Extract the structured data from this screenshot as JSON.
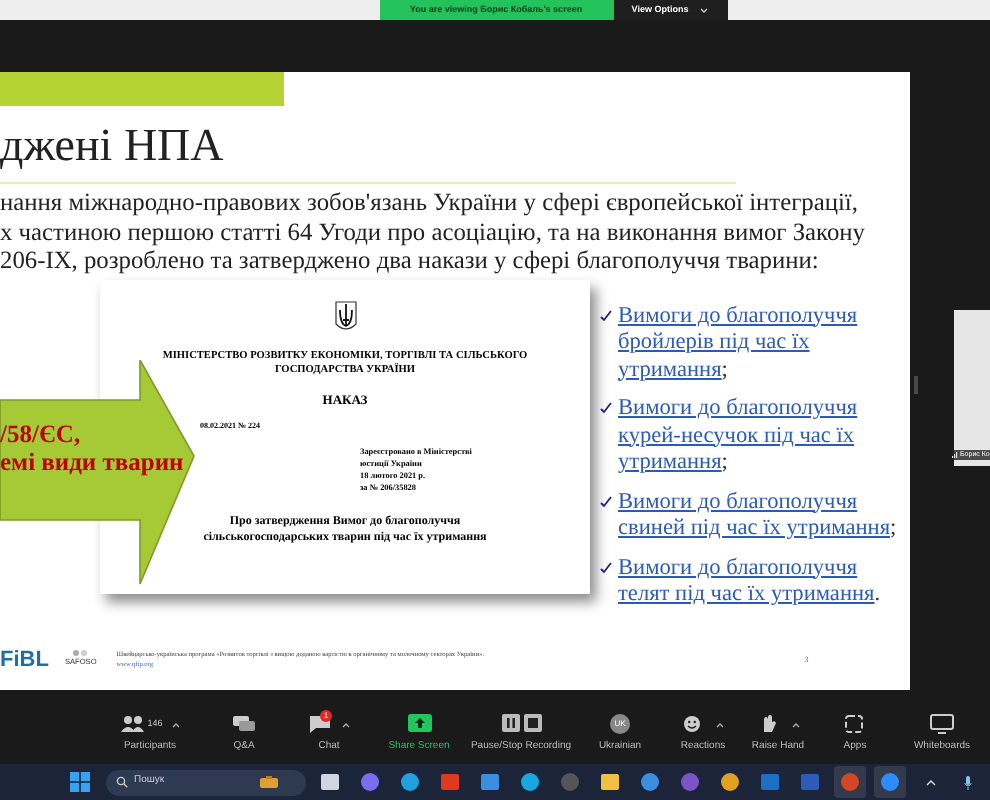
{
  "banner": {
    "message": "You are viewing Борис Кобаль's screen",
    "options": "View Options"
  },
  "slide": {
    "title": "джені НПА",
    "paragraph_lines": [
      "нання міжнародно-правових зобов'язань України у сфері європейської інтеграції,",
      "х частиною першою статті 64 Угоди про асоціацію, та на виконання вимог Закону",
      "206-IX, розроблено та затверджено два накази у сфері благополуччя тварини:"
    ],
    "arrow_lines": [
      "/58/ЄС,",
      "емі види тварин"
    ],
    "document": {
      "ministry": "МІНІСТЕРСТВО РОЗВИТКУ ЕКОНОМІКИ, ТОРГІВЛІ ТА СІЛЬСЬКОГО ГОСПОДАРСТВА УКРАЇНИ",
      "heading": "НАКАЗ",
      "date": "08.02.2021  № 224",
      "registration": [
        "Зареєстровано в Міністерстві",
        "юстиції України",
        "18 лютого 2021 р.",
        "за № 206/35828"
      ],
      "subject": "Про затвердження Вимог до благополуччя сільськогосподарських тварин під час їх утримання"
    },
    "links": [
      {
        "text": "Вимоги до благополуччя бройлерів під час їх утримання",
        "end": ";"
      },
      {
        "text": "Вимоги до благополуччя курей-несучок під час їх утримання",
        "end": ";"
      },
      {
        "text": "Вимоги до благополуччя свиней під час їх утримання",
        "end": ";"
      },
      {
        "text": "Вимоги до благополуччя телят під час їх утримання",
        "end": "."
      }
    ],
    "footer": {
      "logos": [
        "FiBL",
        "SAFOSO"
      ],
      "text": "Швейцарсько-українська програма «Розвиток торгівлі з вищою доданою вартістю в органічному та молочному секторах України».",
      "url": "www.qftp.org",
      "page": "3"
    }
  },
  "video_tile": {
    "name": "Борис Ко"
  },
  "toolbar": [
    {
      "kind": "participants",
      "label": "Participants",
      "count": "146",
      "caret": true
    },
    {
      "kind": "qa",
      "label": "Q&A",
      "caret": false
    },
    {
      "kind": "chat",
      "label": "Chat",
      "badge": "1",
      "caret": true
    },
    {
      "kind": "share",
      "label": "Share Screen",
      "caret": false
    },
    {
      "kind": "record",
      "label": "Pause/Stop Recording",
      "caret": false
    },
    {
      "kind": "language",
      "label": "Ukrainian",
      "code": "UK",
      "caret": false
    },
    {
      "kind": "reactions",
      "label": "Reactions",
      "caret": true
    },
    {
      "kind": "hand",
      "label": "Raise Hand",
      "caret": true
    },
    {
      "kind": "apps",
      "label": "Apps",
      "caret": false
    },
    {
      "kind": "whiteboard",
      "label": "Whiteboards",
      "caret": false
    }
  ],
  "taskbar": {
    "search": {
      "placeholder": "Пошук"
    }
  }
}
